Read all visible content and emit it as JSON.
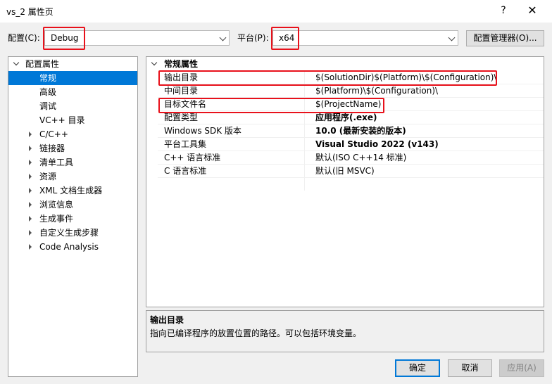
{
  "window": {
    "title": "vs_2 属性页",
    "help": "?",
    "close": "✕"
  },
  "toolbar": {
    "config_label": "配置(C):",
    "config_value": "Debug",
    "platform_label": "平台(P):",
    "platform_value": "x64",
    "config_manager_label": "配置管理器(O)..."
  },
  "tree": {
    "root": "配置属性",
    "items": [
      {
        "label": "常规",
        "selected": true,
        "expandable": false
      },
      {
        "label": "高级",
        "expandable": false
      },
      {
        "label": "调试",
        "expandable": false
      },
      {
        "label": "VC++ 目录",
        "expandable": false
      },
      {
        "label": "C/C++",
        "expandable": true
      },
      {
        "label": "链接器",
        "expandable": true
      },
      {
        "label": "清单工具",
        "expandable": true
      },
      {
        "label": "资源",
        "expandable": true
      },
      {
        "label": "XML 文档生成器",
        "expandable": true
      },
      {
        "label": "浏览信息",
        "expandable": true
      },
      {
        "label": "生成事件",
        "expandable": true
      },
      {
        "label": "自定义生成步骤",
        "expandable": true
      },
      {
        "label": "Code Analysis",
        "expandable": true
      }
    ]
  },
  "grid": {
    "section": "常规属性",
    "rows": [
      {
        "name": "输出目录",
        "value": "$(SolutionDir)$(Platform)\\$(Configuration)\\",
        "bold": false,
        "highlighted": true
      },
      {
        "name": "中间目录",
        "value": "$(Platform)\\$(Configuration)\\",
        "bold": false,
        "highlighted": false
      },
      {
        "name": "目标文件名",
        "value": "$(ProjectName)",
        "bold": false,
        "highlighted": true
      },
      {
        "name": "配置类型",
        "value": "应用程序(.exe)",
        "bold": true,
        "highlighted": false
      },
      {
        "name": "Windows SDK 版本",
        "value": "10.0 (最新安装的版本)",
        "bold": true,
        "highlighted": false
      },
      {
        "name": "平台工具集",
        "value": "Visual Studio 2022 (v143)",
        "bold": true,
        "highlighted": false
      },
      {
        "name": "C++ 语言标准",
        "value": "默认(ISO C++14 标准)",
        "bold": false,
        "highlighted": false
      },
      {
        "name": "C 语言标准",
        "value": "默认(旧 MSVC)",
        "bold": false,
        "highlighted": false
      }
    ]
  },
  "description": {
    "title": "输出目录",
    "text": "指向已编译程序的放置位置的路径。可以包括环境变量。"
  },
  "buttons": {
    "ok": "确定",
    "cancel": "取消",
    "apply": "应用(A)"
  },
  "colors": {
    "selection": "#0078d7",
    "highlight_box": "#e8111b"
  }
}
